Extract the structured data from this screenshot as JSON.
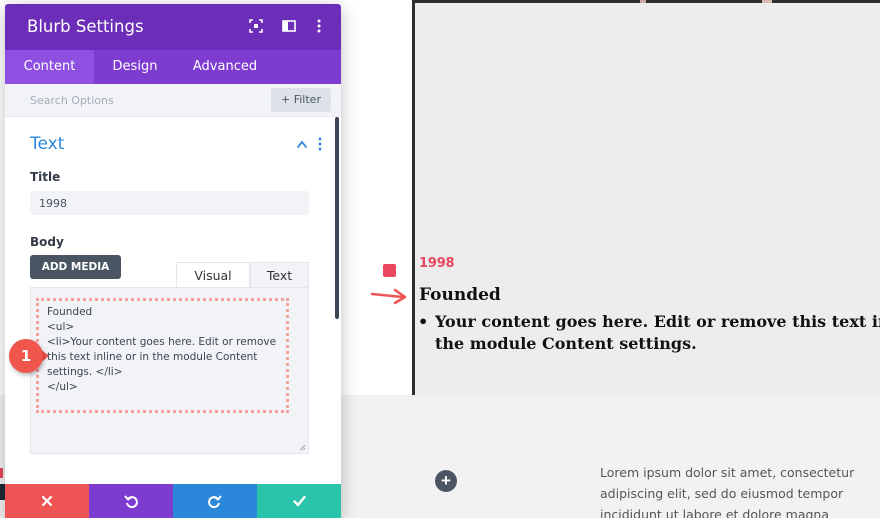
{
  "modal": {
    "title": "Blurb Settings",
    "tabs": [
      {
        "label": "Content",
        "active": true
      },
      {
        "label": "Design",
        "active": false
      },
      {
        "label": "Advanced",
        "active": false
      }
    ],
    "search_placeholder": "Search Options",
    "filter_label": "+ Filter",
    "section_title": "Text",
    "title_field": {
      "label": "Title",
      "value": "1998"
    },
    "body_field": {
      "label": "Body",
      "add_media_label": "ADD MEDIA",
      "editor_tabs": [
        "Visual",
        "Text"
      ],
      "active_editor_tab": "Text",
      "content_lines": [
        "Founded",
        "<ul>",
        "<li>Your content goes here. Edit or remove",
        "this text inline or in the module Content",
        "settings. </li>",
        "</ul>"
      ]
    },
    "step_badge": "1",
    "actions": [
      "cancel",
      "undo",
      "redo",
      "save"
    ]
  },
  "preview": {
    "year": "1998",
    "heading": "Founded",
    "list_item_lines": [
      "Your content goes here. Edit or remove this text inline or in",
      "the module Content settings."
    ]
  },
  "section_below": {
    "lorem_lines": [
      "Lorem ipsum dolor sit amet, consectetur",
      "adipiscing elit, sed do eiusmod tempor",
      "incididunt ut labore et dolore magna"
    ],
    "add_label": "+"
  },
  "colors": {
    "header_purple": "#6c2eb9",
    "tabs_purple": "#7e3bd0",
    "section_blue": "#2b87da",
    "accent_red": "#e8475f",
    "save_green": "#29c4a9",
    "cancel_red": "#ef5455"
  }
}
